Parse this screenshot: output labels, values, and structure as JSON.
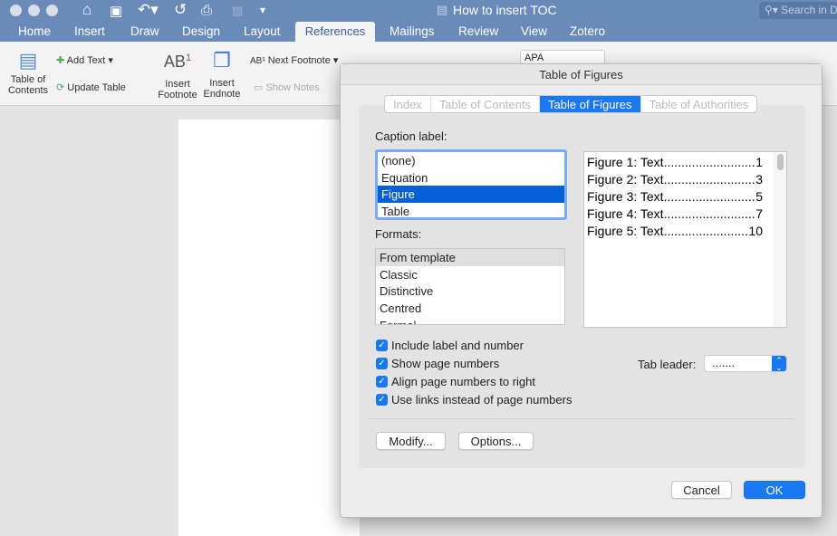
{
  "window": {
    "title": "How to insert TOC",
    "search_placeholder": "Search in Document"
  },
  "quick_access": [
    "home-icon",
    "save-icon",
    "undo-icon",
    "redo-icon",
    "print-icon",
    "format-icon",
    "customize-icon"
  ],
  "ribbon_tabs": [
    "Home",
    "Insert",
    "Draw",
    "Design",
    "Layout",
    "References",
    "Mailings",
    "Review",
    "View",
    "Zotero"
  ],
  "active_tab": "References",
  "ribbon": {
    "toc": "Table of Contents",
    "add_text": "Add Text",
    "update_table": "Update Table",
    "insert_footnote": "Insert Footnote",
    "insert_endnote": "Insert Endnote",
    "next_footnote": "Next Footnote",
    "show_notes": "Show Notes",
    "style": "APA"
  },
  "dialog": {
    "title": "Table of Figures",
    "tabs": [
      "Index",
      "Table of Contents",
      "Table of Figures",
      "Table of Authorities"
    ],
    "active_tab": "Table of Figures",
    "caption_label": "Caption label:",
    "caption_options": [
      "(none)",
      "Equation",
      "Figure",
      "Table"
    ],
    "caption_selected": "Figure",
    "formats_label": "Formats:",
    "formats": [
      "From template",
      "Classic",
      "Distinctive",
      "Centred",
      "Formal"
    ],
    "format_selected": "From template",
    "preview": [
      {
        "text": "Figure 1: Text",
        "page": "1"
      },
      {
        "text": "Figure 2: Text",
        "page": "3"
      },
      {
        "text": "Figure 3: Text",
        "page": "5"
      },
      {
        "text": "Figure 4: Text",
        "page": "7"
      },
      {
        "text": "Figure 5: Text",
        "page": "10"
      }
    ],
    "checkboxes": [
      {
        "label": "Include label and number",
        "checked": true
      },
      {
        "label": "Show page numbers",
        "checked": true
      },
      {
        "label": "Align page numbers to right",
        "checked": true
      },
      {
        "label": "Use links instead of page numbers",
        "checked": true
      }
    ],
    "tab_leader_label": "Tab leader:",
    "tab_leader_value": ".......",
    "modify": "Modify...",
    "options": "Options...",
    "cancel": "Cancel",
    "ok": "OK"
  },
  "colors": {
    "titlebar": "#6a8bba",
    "accent": "#1a79f0"
  }
}
